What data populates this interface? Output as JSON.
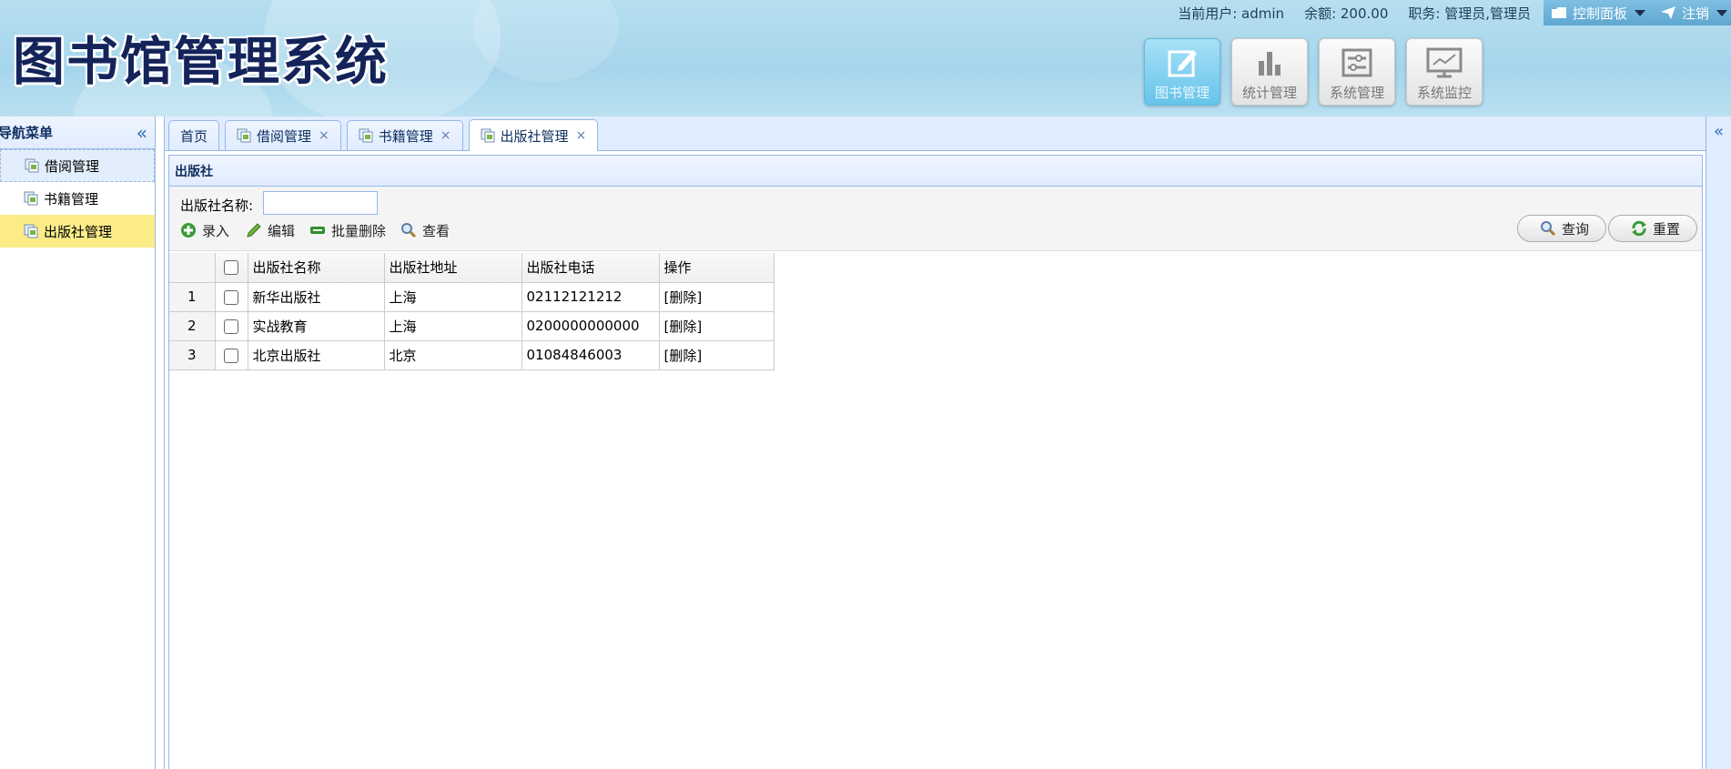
{
  "header": {
    "system_title": "图书馆管理系统",
    "current_user_label": "当前用户: admin",
    "balance_label": "余额: 200.00",
    "role_label": "职务: 管理员,管理员",
    "control_panel_label": "控制面板",
    "logout_label": "注销"
  },
  "modules": [
    {
      "label": "图书管理",
      "icon": "edit-icon",
      "active": true
    },
    {
      "label": "统计管理",
      "icon": "bar-chart-icon",
      "active": false
    },
    {
      "label": "系统管理",
      "icon": "settings-sliders-icon",
      "active": false
    },
    {
      "label": "系统监控",
      "icon": "monitor-icon",
      "active": false
    }
  ],
  "left_nav": {
    "title": "导航菜单",
    "items": [
      {
        "label": "借阅管理",
        "state": "hover"
      },
      {
        "label": "书籍管理",
        "state": "normal"
      },
      {
        "label": "出版社管理",
        "state": "selected"
      }
    ]
  },
  "tabs": [
    {
      "label": "首页",
      "closable": false,
      "active": false
    },
    {
      "label": "借阅管理",
      "closable": true,
      "active": false
    },
    {
      "label": "书籍管理",
      "closable": true,
      "active": false
    },
    {
      "label": "出版社管理",
      "closable": true,
      "active": true
    }
  ],
  "panel": {
    "title": "出版社",
    "search_label": "出版社名称:",
    "search_value": "",
    "toolbar": {
      "add": "录入",
      "edit": "编辑",
      "batch_delete": "批量删除",
      "view": "查看",
      "query": "查询",
      "reset": "重置"
    }
  },
  "table": {
    "columns": [
      "出版社名称",
      "出版社地址",
      "出版社电话",
      "操作"
    ],
    "rows": [
      {
        "num": "1",
        "name": "新华出版社",
        "address": "上海",
        "phone": "02112121212",
        "action": "[删除]"
      },
      {
        "num": "2",
        "name": "实战教育",
        "address": "上海",
        "phone": "0200000000000",
        "action": "[删除]"
      },
      {
        "num": "3",
        "name": "北京出版社",
        "address": "北京",
        "phone": "01084846003",
        "action": "[删除]"
      }
    ]
  },
  "colors": {
    "header_bg": "#a6d5eb",
    "panel_border": "#95b8e7",
    "selected_nav": "#fbec88",
    "active_module": "#66c4ea"
  }
}
